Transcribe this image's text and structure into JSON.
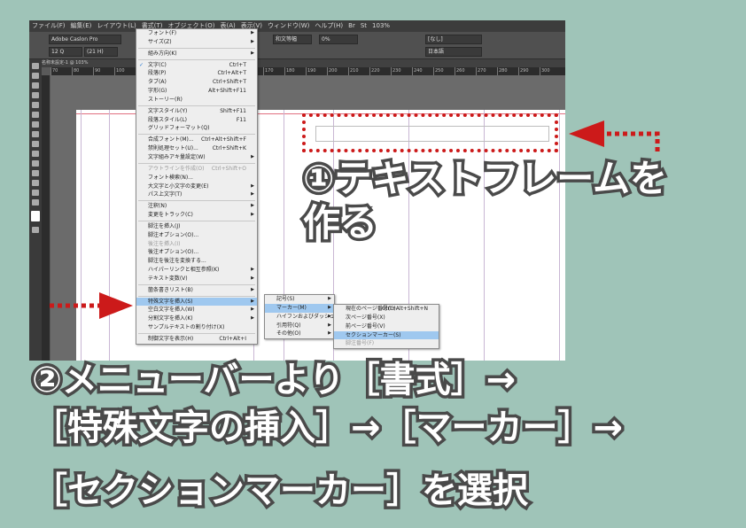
{
  "menubar": {
    "items": [
      "ファイル(F)",
      "編集(E)",
      "レイアウト(L)",
      "書式(T)",
      "オブジェクト(O)",
      "表(A)",
      "表示(V)",
      "ウィンドウ(W)",
      "ヘルプ(H)",
      "Br",
      "St",
      "103%"
    ]
  },
  "control": {
    "font_name": "Adobe Caslon Pro",
    "font_size": "12 Q",
    "leading": "(21 H)",
    "kerning": "和文等幅",
    "tracking": "0%",
    "style": "[なし]",
    "language": "日本語"
  },
  "tab": {
    "label": "名称未設定-1 @ 103%"
  },
  "ruler": {
    "ticks": [
      "70",
      "80",
      "90",
      "100",
      "110",
      "120",
      "130",
      "140",
      "150",
      "160",
      "170",
      "180",
      "190",
      "200",
      "210",
      "220",
      "230",
      "240",
      "250",
      "260",
      "270",
      "280",
      "290",
      "300"
    ]
  },
  "format_menu": {
    "items": [
      {
        "label": "フォント(F)",
        "shortcut": "",
        "arrow": true
      },
      {
        "label": "サイズ(Z)",
        "shortcut": "",
        "arrow": true
      },
      {
        "sep": true
      },
      {
        "label": "組み方向(K)",
        "shortcut": "",
        "arrow": true
      },
      {
        "sep": true
      },
      {
        "label": "文字(C)",
        "shortcut": "Ctrl+T",
        "check": true
      },
      {
        "label": "段落(P)",
        "shortcut": "Ctrl+Alt+T"
      },
      {
        "label": "タブ(A)",
        "shortcut": "Ctrl+Shift+T"
      },
      {
        "label": "字形(G)",
        "shortcut": "Alt+Shift+F11"
      },
      {
        "label": "ストーリー(R)",
        "shortcut": ""
      },
      {
        "sep": true
      },
      {
        "label": "文字スタイル(Y)",
        "shortcut": "Shift+F11"
      },
      {
        "label": "段落スタイル(L)",
        "shortcut": "F11"
      },
      {
        "label": "グリッドフォーマット(Q)",
        "shortcut": ""
      },
      {
        "sep": true
      },
      {
        "label": "合成フォント(M)...",
        "shortcut": "Ctrl+Alt+Shift+F"
      },
      {
        "label": "禁則処理セット(U)...",
        "shortcut": "Ctrl+Shift+K"
      },
      {
        "label": "文字組みアキ量設定(W)",
        "shortcut": "",
        "arrow": true
      },
      {
        "sep": true
      },
      {
        "label": "アウトラインを作成(O)",
        "shortcut": "Ctrl+Shift+O",
        "disabled": true
      },
      {
        "label": "フォント検索(N)...",
        "shortcut": ""
      },
      {
        "label": "大文字と小文字の変更(E)",
        "shortcut": "",
        "arrow": true
      },
      {
        "label": "パス上文字(T)",
        "shortcut": "",
        "arrow": true
      },
      {
        "sep": true
      },
      {
        "label": "注釈(N)",
        "shortcut": "",
        "arrow": true
      },
      {
        "label": "変更をトラック(C)",
        "shortcut": "",
        "arrow": true
      },
      {
        "sep": true
      },
      {
        "label": "脚注を挿入(J)",
        "shortcut": ""
      },
      {
        "label": "脚注オプション(O)...",
        "shortcut": ""
      },
      {
        "label": "後注を挿入(I)",
        "shortcut": "",
        "disabled": true
      },
      {
        "label": "後注オプション(O)...",
        "shortcut": ""
      },
      {
        "label": "脚注を後注を変換する...",
        "shortcut": ""
      },
      {
        "label": "ハイパーリンクと相互参照(K)",
        "shortcut": "",
        "arrow": true
      },
      {
        "label": "テキスト変数(V)",
        "shortcut": "",
        "arrow": true
      },
      {
        "sep": true
      },
      {
        "label": "箇条書きリスト(B)",
        "shortcut": "",
        "arrow": true
      },
      {
        "sep": true
      },
      {
        "label": "特殊文字を挿入(S)",
        "shortcut": "",
        "arrow": true,
        "highlight": true
      },
      {
        "label": "空白文字を挿入(W)",
        "shortcut": "",
        "arrow": true
      },
      {
        "label": "分割文字を挿入(K)",
        "shortcut": "",
        "arrow": true
      },
      {
        "label": "サンプルテキストの割り付け(X)",
        "shortcut": ""
      },
      {
        "sep": true
      },
      {
        "label": "制御文字を表示(H)",
        "shortcut": "Ctrl+Alt+I"
      }
    ]
  },
  "special_menu": {
    "items": [
      {
        "label": "記号(S)",
        "arrow": true
      },
      {
        "label": "マーカー(M)",
        "arrow": true,
        "highlight": true
      },
      {
        "label": "ハイフンおよびダッシュ(H)",
        "arrow": true
      },
      {
        "label": "引用符(Q)",
        "arrow": true
      },
      {
        "label": "その他(O)",
        "arrow": true
      }
    ]
  },
  "marker_menu": {
    "items": [
      {
        "label": "現在のページ番号(C)",
        "shortcut": "Ctrl+Alt+Shift+N"
      },
      {
        "label": "次ページ番号(X)",
        "shortcut": ""
      },
      {
        "label": "前ページ番号(V)",
        "shortcut": ""
      },
      {
        "label": "セクションマーカー(S)",
        "shortcut": "",
        "highlight": true
      },
      {
        "label": "脚注番号(F)",
        "shortcut": "",
        "disabled": true
      }
    ]
  },
  "captions": {
    "step1_line1": "①テキストフレームを",
    "step1_line2": "作る",
    "step2_line1": "②メニューバーより［書式］→",
    "step2_line2": "［特殊文字の挿入］→［マーカー］→",
    "step2_line3": "［セクションマーカー］を選択"
  },
  "colors": {
    "background": "#9fc4b8",
    "arrow": "#cc1a1a",
    "highlight": "#9fc8ef"
  }
}
